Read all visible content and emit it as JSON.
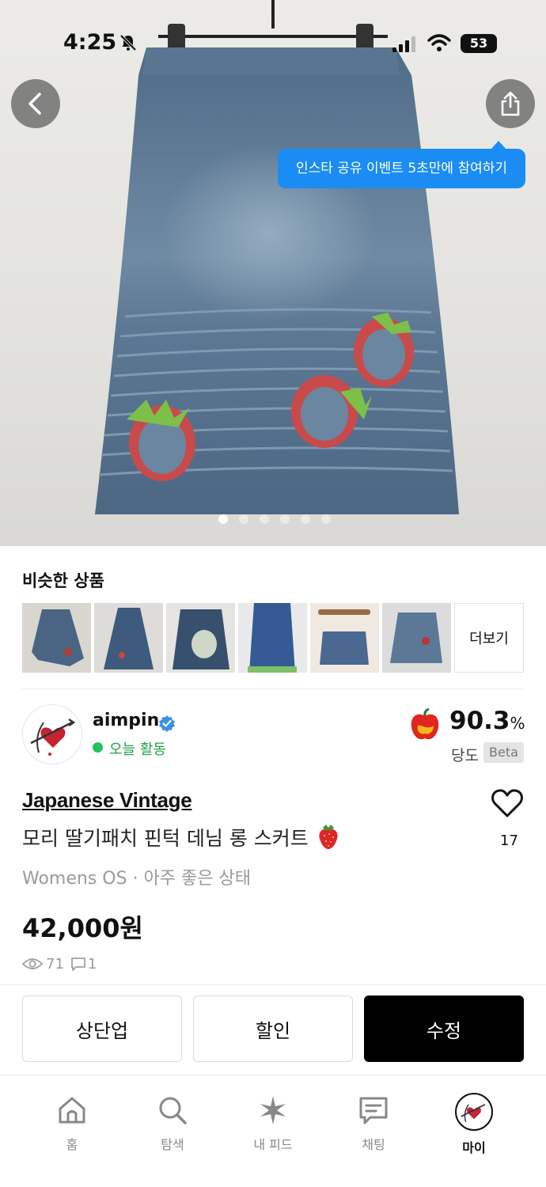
{
  "status_bar": {
    "time": "4:25",
    "battery": "53"
  },
  "hero": {
    "tooltip": "인스타 공유 이벤트 5초만에 참여하기",
    "image_count": 6,
    "active_index": 0
  },
  "similar": {
    "title": "비슷한 상품",
    "more_label": "더보기",
    "thumbs": [
      "skirt-thumb-1",
      "skirt-thumb-2",
      "skirt-thumb-3",
      "skirt-thumb-4",
      "skirt-thumb-5",
      "skirt-thumb-6"
    ]
  },
  "seller": {
    "name": "aimpin",
    "activity": "오늘 활동",
    "score": "90.3",
    "score_unit": "%",
    "score_label": "당도",
    "score_badge": "Beta"
  },
  "product": {
    "brand": "Japanese Vintage",
    "title": "모리 딸기패치 핀턱 데님 롱 스커트",
    "likes": "17",
    "meta": "Womens OS · 아주 좋은 상태",
    "price": "42,000원",
    "views": "71",
    "comments": "1"
  },
  "actions": {
    "bump": "상단업",
    "discount": "할인",
    "edit": "수정"
  },
  "nav": {
    "home": "홈",
    "search": "탐색",
    "feed": "내 피드",
    "chat": "채팅",
    "my": "마이"
  },
  "colors": {
    "accent_blue": "#1a8cf4",
    "active_green": "#20c35a",
    "primary_black": "#000000"
  }
}
